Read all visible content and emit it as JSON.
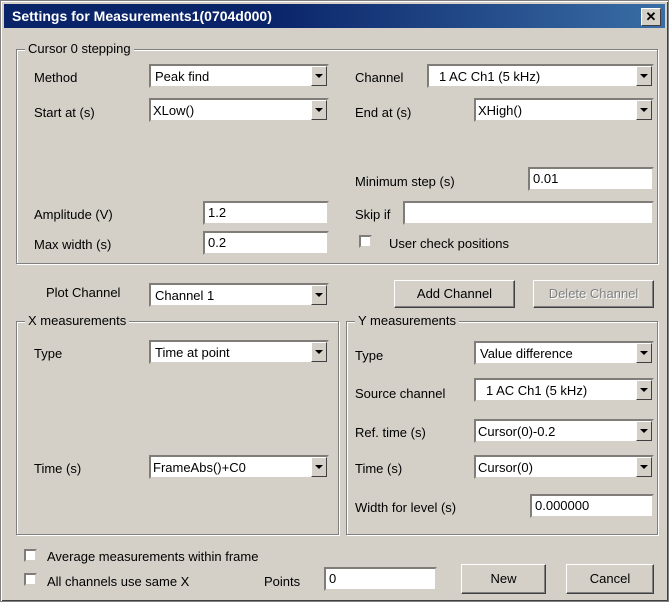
{
  "window": {
    "title": "Settings for Measurements1(0704d000)",
    "close_glyph": "✕"
  },
  "cursor_group": {
    "legend": "Cursor 0 stepping",
    "method_label": "Method",
    "method_value": "Peak find",
    "channel_label": "Channel",
    "channel_value": "1 AC Ch1 (5 kHz)",
    "start_label": "Start at (s)",
    "start_value": "XLow()",
    "end_label": "End at (s)",
    "end_value": "XHigh()",
    "min_step_label": "Minimum step (s)",
    "min_step_value": "0.01",
    "amplitude_label": "Amplitude (V)",
    "amplitude_value": "1.2",
    "skip_if_label": "Skip if",
    "skip_if_value": "",
    "max_width_label": "Max width (s)",
    "max_width_value": "0.2",
    "user_check_label": "User check positions",
    "user_check_checked": false
  },
  "plot_channel": {
    "label": "Plot Channel",
    "value": "Channel 1",
    "add_button": "Add Channel",
    "delete_button": "Delete Channel"
  },
  "x_measurements": {
    "legend": "X measurements",
    "type_label": "Type",
    "type_value": "Time at point",
    "time_label": "Time (s)",
    "time_value": "FrameAbs()+C0"
  },
  "y_measurements": {
    "legend": "Y measurements",
    "type_label": "Type",
    "type_value": "Value difference",
    "source_label": "Source channel",
    "source_value": "1 AC Ch1 (5 kHz)",
    "ref_time_label": "Ref. time (s)",
    "ref_time_value": "Cursor(0)-0.2",
    "time_label": "Time (s)",
    "time_value": "Cursor(0)",
    "width_label": "Width for level (s)",
    "width_value": "0.000000"
  },
  "footer": {
    "average_label": "Average measurements within frame",
    "all_channels_label": "All channels use same X",
    "points_label": "Points",
    "points_value": "0",
    "new_button": "New",
    "cancel_button": "Cancel"
  }
}
